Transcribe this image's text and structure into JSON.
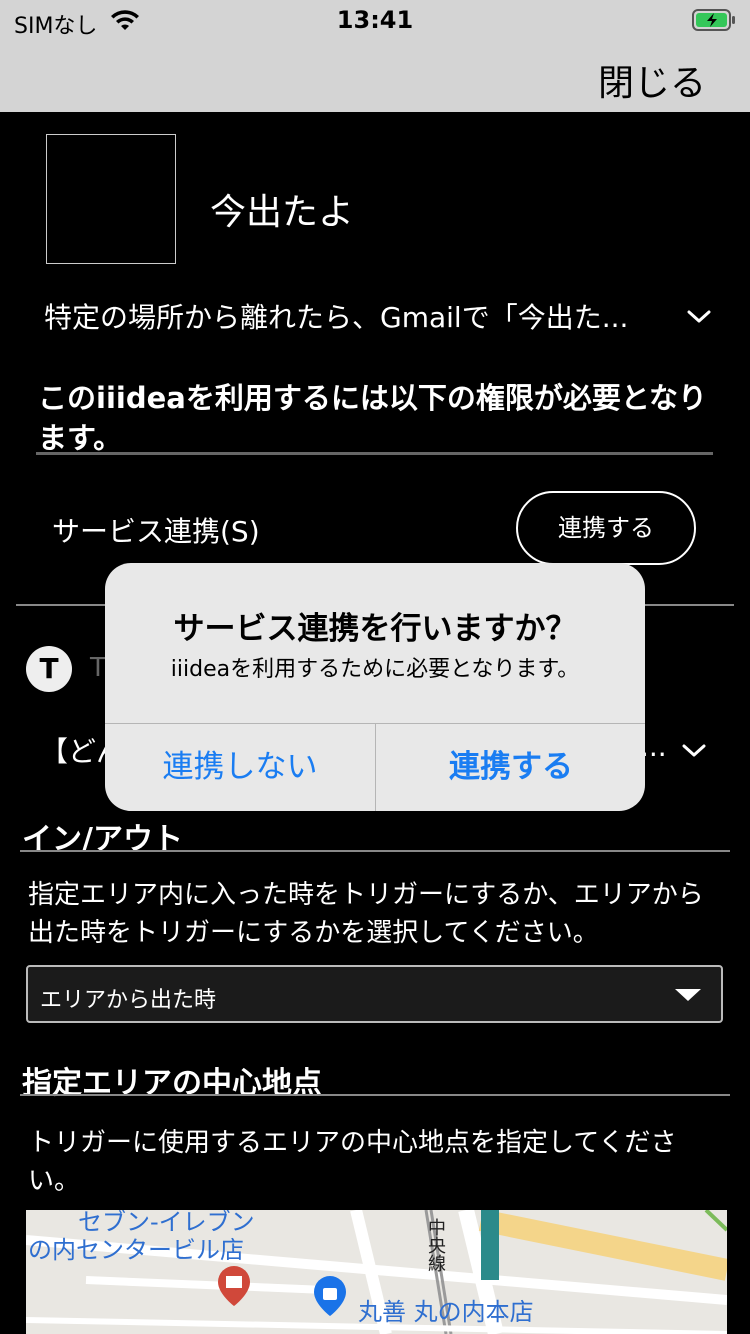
{
  "status_bar": {
    "carrier": "SIMなし",
    "time": "13:41"
  },
  "nav": {
    "close_label": "閉じる"
  },
  "app": {
    "title": "今出たよ",
    "description": "特定の場所から離れたら、Gmailで「今出た..."
  },
  "permissions": {
    "title": "このiiideaを利用するには以下の権限が必要となります。",
    "service_label": "サービス連携(S)",
    "link_button": "連携する"
  },
  "second_item": {
    "avatar_letter": "T",
    "name_partial": "T",
    "text_partial": "【どん",
    "text_end": "..."
  },
  "in_out": {
    "heading": "イン/アウト",
    "description": "指定エリア内に入った時をトリガーにするか、エリアから出た時をトリガーにするかを選択してください。",
    "selected": "エリアから出た時"
  },
  "center": {
    "heading": "指定エリアの中心地点",
    "description": "トリガーに使用するエリアの中心地点を指定してください。"
  },
  "map": {
    "label_top": "セブン-イレブン",
    "label_building": "の内センタービル店",
    "label_street": "中央線",
    "label_store": "丸善 丸の内本店"
  },
  "alert": {
    "title": "サービス連携を行いますか？",
    "message": "iiideaを利用するために必要となります。",
    "cancel": "連携しない",
    "confirm": "連携する"
  },
  "colors": {
    "accent": "#1a7df2",
    "bar": "#d4d4d4"
  }
}
